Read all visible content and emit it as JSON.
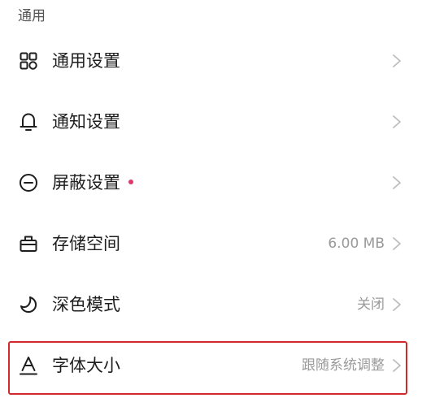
{
  "section": {
    "title": "通用"
  },
  "items": [
    {
      "label": "通用设置",
      "icon": "grid-apps-icon",
      "value": "",
      "has_dot": false
    },
    {
      "label": "通知设置",
      "icon": "bell-icon",
      "value": "",
      "has_dot": false
    },
    {
      "label": "屏蔽设置",
      "icon": "minus-circle-icon",
      "value": "",
      "has_dot": true
    },
    {
      "label": "存储空间",
      "icon": "storage-box-icon",
      "value": "6.00 MB",
      "has_dot": false
    },
    {
      "label": "深色模式",
      "icon": "moon-icon",
      "value": "关闭",
      "has_dot": false
    },
    {
      "label": "字体大小",
      "icon": "font-size-icon",
      "value": "跟随系统调整",
      "has_dot": false,
      "highlighted": true
    }
  ],
  "colors": {
    "dot": "#e0386a",
    "highlight_border": "#d22a2a",
    "chevron": "#bdbdbd",
    "value_text": "#9a9a9a"
  }
}
